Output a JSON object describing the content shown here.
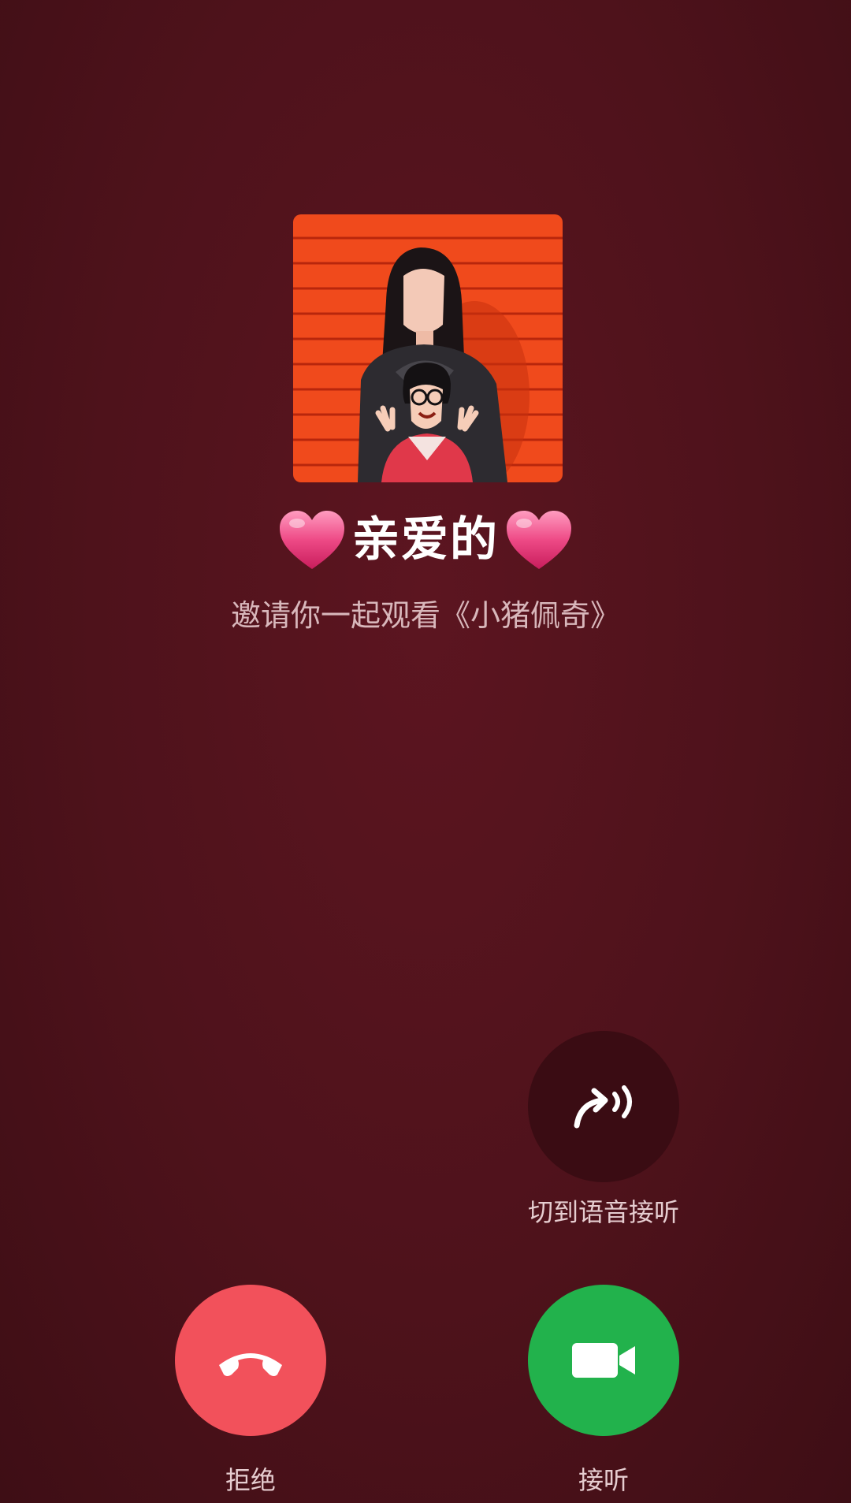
{
  "caller": {
    "name": "亲爱的",
    "invite_text": "邀请你一起观看《小猪佩奇》"
  },
  "actions": {
    "switch_voice_label": "切到语音接听",
    "decline_label": "拒绝",
    "accept_label": "接听"
  },
  "icons": {
    "heart": "heart-icon",
    "switch_voice": "voice-switch-icon",
    "decline": "phone-hangup-icon",
    "accept": "video-camera-icon"
  },
  "colors": {
    "background": "#4e121b",
    "decline": "#f2515b",
    "accept": "#22b24c",
    "voice_button": "#3a0c13",
    "heart": "#e83d7a"
  }
}
